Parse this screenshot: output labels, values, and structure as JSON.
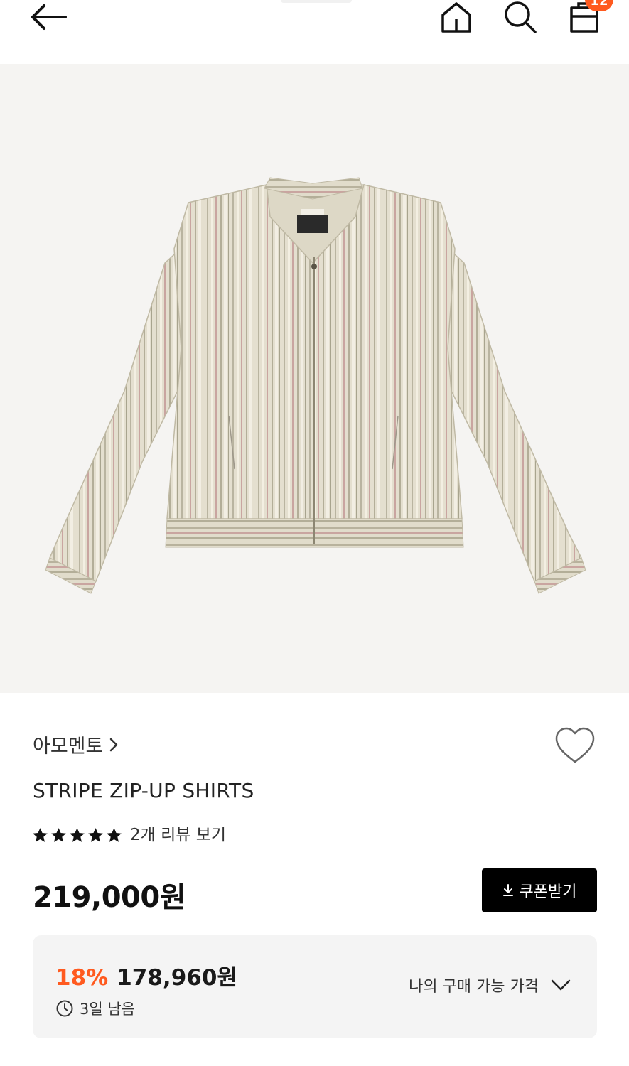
{
  "header": {
    "cart_count": "12",
    "icons": [
      "back-arrow-icon",
      "home-icon",
      "search-icon",
      "cart-icon"
    ]
  },
  "product": {
    "brand": "아모멘토",
    "name": "STRIPE ZIP-UP SHIRTS",
    "rating": 5,
    "review_link": "2개 리뷰 보기",
    "price": "219,000원",
    "coupon_label": "쿠폰받기",
    "discount": "18%",
    "sale_price": "178,960원",
    "time_left": "3일 남음",
    "my_price_label": "나의 구매 가능 가격"
  },
  "colors": {
    "accent": "#ff5a1f",
    "image_bg": "#f5f4f2",
    "box_bg": "#f4f4f4"
  }
}
